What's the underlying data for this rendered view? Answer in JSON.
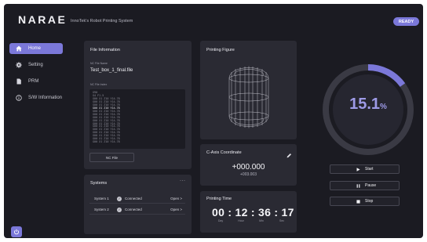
{
  "app": {
    "logo": "NARAE",
    "subtitle": "InnoTek's Robot Printing System",
    "status_badge": "READY"
  },
  "sidebar": {
    "items": [
      {
        "label": "Home",
        "icon": "home-icon",
        "active": true
      },
      {
        "label": "Setting",
        "icon": "gear-icon",
        "active": false
      },
      {
        "label": "PRM",
        "icon": "document-icon",
        "active": false
      },
      {
        "label": "S/W Information",
        "icon": "info-icon",
        "active": false
      }
    ]
  },
  "file_info": {
    "title": "File Information",
    "nc_file_name_label": "NC File Name",
    "nc_file_name": "Test_box_1_final.file",
    "nc_file_index_label": "NC File Index",
    "nc_lines": [
      "G90",
      "G4 F1.5",
      "G00 X1 Z10 Y14.78",
      "G00 X1 Z10 Y14.78",
      "G00 X1 Z10 Y14.78",
      "G00 X1 Z10 Y14.78",
      "G00 X1 Z10 Y14.78",
      "G00 X1 Z10 Y14.78",
      "G00 X1 Z10 Y14.78",
      "G00 X1 Z10 Y14.78",
      "G00 X1 Z10 Y14.78",
      "G00 X1 Z10 Y14.78",
      "G00 X1 Z10 Y14.78",
      "G00 X1 Z10 Y14.78",
      "G00 X1 Z10 Y14.78",
      "G00 X1 Z10 Y14.78",
      "G00 X1 Z10 Y14.78"
    ],
    "nc_file_button": "NC File"
  },
  "systems": {
    "title": "Systems",
    "more": "···",
    "rows": [
      {
        "name": "System 1",
        "status": "Connected",
        "action": "Open >"
      },
      {
        "name": "System 2",
        "status": "Connected",
        "action": "Open >"
      }
    ]
  },
  "printing_figure": {
    "title": "Printing Figure"
  },
  "c_axis": {
    "title": "C-Axis Coordinate",
    "value": "+000.000",
    "sub_value": "+003.003"
  },
  "printing_time": {
    "title": "Printing Time",
    "value": "00 : 12 : 36 : 17",
    "units": [
      "Day",
      "Hour",
      "Min",
      "Sec"
    ]
  },
  "progress": {
    "value": "15.1",
    "unit": "%",
    "fraction": 0.151,
    "accent": "#7b78d9"
  },
  "controls": [
    {
      "label": "Start",
      "icon": "play-icon"
    },
    {
      "label": "Pause",
      "icon": "pause-icon"
    },
    {
      "label": "Stop",
      "icon": "stop-icon"
    }
  ]
}
